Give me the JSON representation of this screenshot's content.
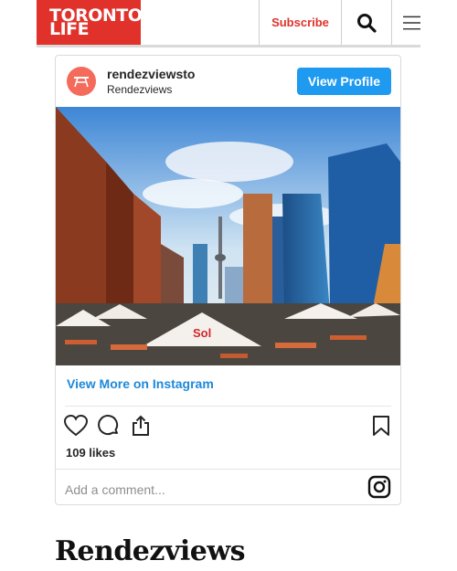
{
  "header": {
    "logo_line1": "TORONTO",
    "logo_line2": "LIFE",
    "subscribe_label": "Subscribe",
    "icons": [
      "search-icon",
      "hamburger-menu-icon"
    ],
    "brand_color": "#e0322b"
  },
  "instagram_embed": {
    "username": "rendezviewsto",
    "display_name": "Rendezviews",
    "view_profile_label": "View Profile",
    "view_more_label": "View More on Instagram",
    "likes": "109 likes",
    "comment_placeholder": "Add a comment...",
    "icons": [
      "heart-icon",
      "comment-icon",
      "share-icon",
      "bookmark-icon",
      "instagram-icon"
    ],
    "accent_color": "#1e9af0"
  },
  "article": {
    "title": "Rendezviews"
  }
}
